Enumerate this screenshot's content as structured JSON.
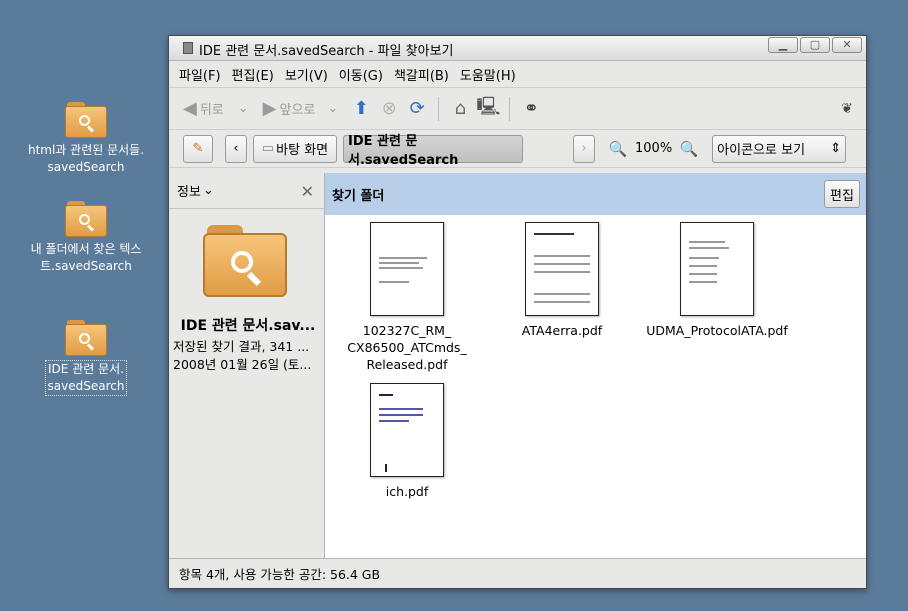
{
  "desktop": {
    "icons": [
      {
        "label": "html과 관련된 문서들.savedSearch",
        "line1": "html과 관련된 문서들.",
        "line2": "savedSearch"
      },
      {
        "label": "내 폴더에서 찾은 텍스트.savedSearch",
        "line1": "내 폴더에서 찾은 텍스",
        "line2": "트.savedSearch"
      },
      {
        "label": "IDE 관련 문서.savedSearch",
        "line1": "IDE 관련 문서.",
        "line2": "savedSearch"
      }
    ]
  },
  "window": {
    "title": "IDE 관련 문서.savedSearch - 파일 찾아보기",
    "menu": [
      "파일(F)",
      "편집(E)",
      "보기(V)",
      "이동(G)",
      "책갈피(B)",
      "도움말(H)"
    ],
    "toolbar": {
      "back": "뒤로",
      "forward": "앞으로"
    },
    "location": {
      "crumb_desktop": "바탕 화면",
      "crumb_current": "IDE 관련 문서.savedSearch",
      "zoom": "100%",
      "view_mode": "아이콘으로 보기"
    },
    "sidepane": {
      "header": "정보",
      "name": "IDE 관련 문서.sav...",
      "desc": "저장된 찾기 결과, 341 ...",
      "date": "2008년 01월 26일 (토..."
    },
    "infobar": {
      "label": "찾기 폴더",
      "edit": "편집"
    },
    "files": [
      {
        "line1": "102327C_RM_",
        "line2": "CX86500_ATCmds_",
        "line3": "Released.pdf"
      },
      {
        "line1": "ATA4erra.pdf",
        "line2": "",
        "line3": ""
      },
      {
        "line1": "UDMA_ProtocolATA.pdf",
        "line2": "",
        "line3": ""
      },
      {
        "line1": "ich.pdf",
        "line2": "",
        "line3": ""
      }
    ],
    "status": "항목 4개, 사용 가능한 공간: 56.4 GB"
  },
  "colors": {
    "desktop": "#5b7b9b",
    "infobar": "#b8cfe9",
    "folder": "#e29c45"
  }
}
